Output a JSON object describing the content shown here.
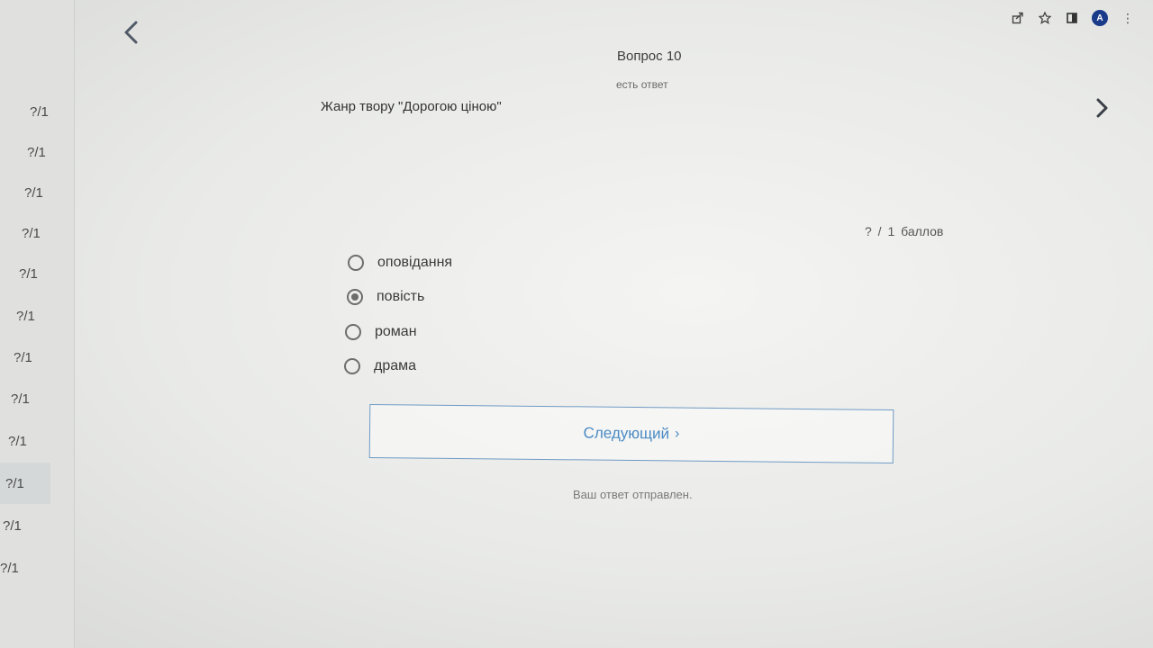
{
  "sidebar": {
    "items": [
      {
        "label": "?/1",
        "active": false
      },
      {
        "label": "?/1",
        "active": false
      },
      {
        "label": "?/1",
        "active": false
      },
      {
        "label": "?/1",
        "active": false
      },
      {
        "label": "?/1",
        "active": false
      },
      {
        "label": "?/1",
        "active": false
      },
      {
        "label": "?/1",
        "active": false
      },
      {
        "label": "?/1",
        "active": false
      },
      {
        "label": "?/1",
        "active": false
      },
      {
        "label": "?/1",
        "active": true
      },
      {
        "label": "?/1",
        "active": false
      },
      {
        "label": "?/1",
        "active": false
      }
    ]
  },
  "toolbar": {
    "icons": [
      "share-icon",
      "star-icon",
      "reader-icon"
    ],
    "avatar_letter": "A"
  },
  "question": {
    "title": "Вопрос 10",
    "status": "есть ответ",
    "text": "Жанр твору \"Дорогою ціною\"",
    "points": "? / 1 баллов"
  },
  "options": [
    {
      "label": "оповідання",
      "selected": false
    },
    {
      "label": "повість",
      "selected": true
    },
    {
      "label": "роман",
      "selected": false
    },
    {
      "label": "драма",
      "selected": false
    }
  ],
  "next_button": {
    "label": "Следующий",
    "chevron": "›"
  },
  "submitted_message": "Ваш ответ отправлен.",
  "colors": {
    "accent": "#4a8ac4",
    "button_border": "#6f9ac4",
    "radio": "#6d6d6d"
  }
}
